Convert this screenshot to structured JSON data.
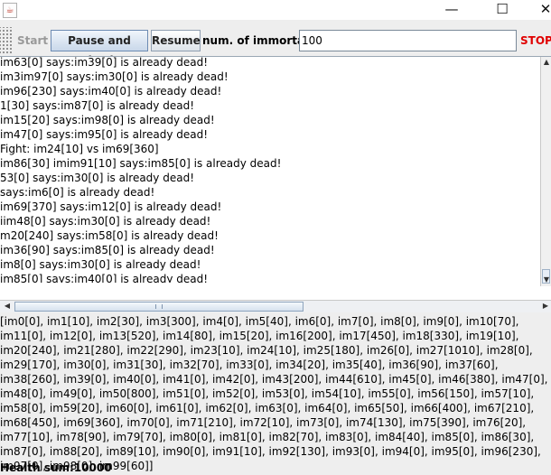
{
  "window": {
    "minimize_glyph": "—",
    "maximize_glyph": "☐",
    "close_glyph": "✕",
    "app_icon": "java-icon"
  },
  "toolbar": {
    "start_label": "Start",
    "pause_label": "Pause and check",
    "resume_label": "Resume",
    "immortals_label": "num. of immortals:",
    "immortals_value": "100",
    "stop_label": "STOP"
  },
  "log": {
    "lines": [
      "im63[0] says:im39[0] is already dead!",
      "im3im97[0] says:im30[0] is already dead!",
      "im96[230] says:im40[0] is already dead!",
      "1[30] says:im87[0] is already dead!",
      "im15[20] says:im98[0] is already dead!",
      "im47[0] says:im95[0] is already dead!",
      "Fight: im24[10] vs im69[360]",
      "im86[30] imim91[10] says:im85[0] is already dead!",
      "53[0] says:im30[0] is already dead!",
      "says:im6[0] is already dead!",
      "im69[370] says:im12[0] is already dead!",
      "iim48[0] says:im30[0] is already dead!",
      "m20[240] says:im58[0] is already dead!",
      "im36[90] says:im85[0] is already dead!",
      "im8[0] says:im30[0] is already dead!",
      "im85[0] says:im40[0] is already dead!"
    ]
  },
  "summary": {
    "text": "[im0[0], im1[10], im2[30], im3[300], im4[0], im5[40], im6[0], im7[0], im8[0], im9[0], im10[70], im11[0], im12[0], im13[520], im14[80], im15[20], im16[200], im17[450], im18[330], im19[10], im20[240], im21[280], im22[290], im23[10], im24[10], im25[180], im26[0], im27[1010], im28[0], im29[170], im30[0], im31[30], im32[70], im33[0], im34[20], im35[40], im36[90], im37[60], im38[260], im39[0], im40[0], im41[0], im42[0], im43[200], im44[610], im45[0], im46[380], im47[0], im48[0], im49[0], im50[800], im51[0], im52[0], im53[0], im54[10], im55[0], im56[150], im57[10], im58[0], im59[20], im60[0], im61[0], im62[0], im63[0], im64[0], im65[50], im66[400], im67[210], im68[450], im69[360], im70[0], im71[210], im72[10], im73[0], im74[130], im75[390], im76[20], im77[10], im78[90], im79[70], im80[0], im81[0], im82[70], im83[0], im84[40], im85[0], im86[30], im87[0], im88[20], im89[10], im90[0], im91[10], im92[130], im93[0], im94[0], im95[0], im96[230], im97[0], im98[0], im99[60]]",
    "health_sum": "Health sum:10000"
  },
  "colors": {
    "stop": "#e00000",
    "button_border": "#8f9eb1"
  }
}
